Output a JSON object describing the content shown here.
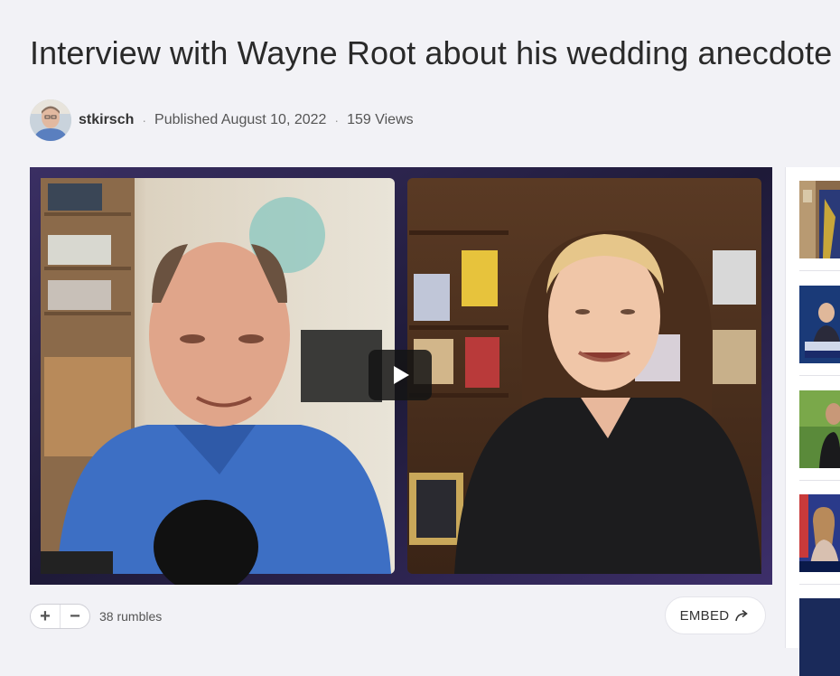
{
  "video": {
    "title": "Interview with Wayne Root about his wedding anecdote"
  },
  "channel": {
    "name": "stkirsch",
    "published": "Published August 10, 2022",
    "views": "159 Views"
  },
  "separators": {
    "dot": "·"
  },
  "player": {
    "play_icon": "play-icon"
  },
  "actions": {
    "upvote_symbol": "+",
    "downvote_symbol": "−",
    "rumbles": "38 rumbles",
    "embed_label": "EMBED",
    "embed_icon": "share-arrow-icon"
  },
  "sidebar": {
    "thumbnail_count": 5
  },
  "colors": {
    "background": "#f2f2f6",
    "player_frame": "#2a2448",
    "play_button": "#141414"
  }
}
